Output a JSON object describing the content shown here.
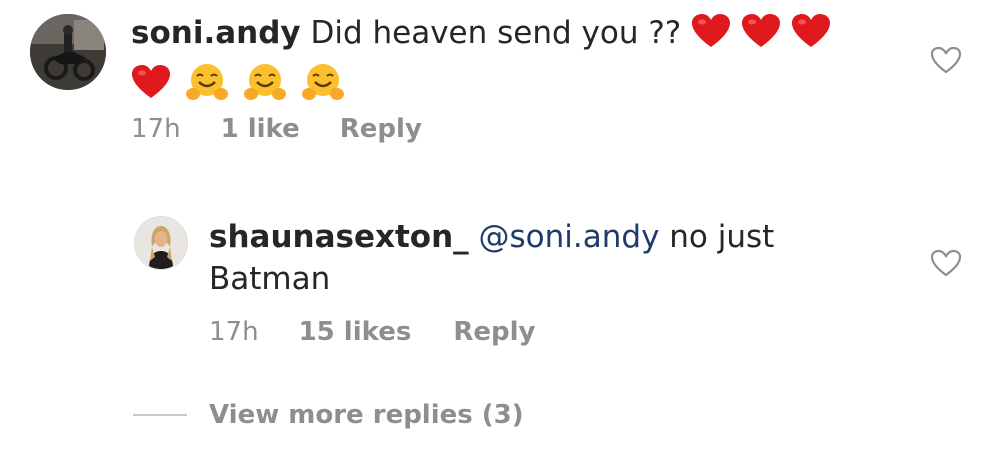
{
  "comments": [
    {
      "username": "soni.andy",
      "text": "Did heaven send you ??",
      "emoji_line1": [
        "heart",
        "heart",
        "heart"
      ],
      "emoji_line2": [
        "heart",
        "hug",
        "hug",
        "hug"
      ],
      "time": "17h",
      "likes": "1 like",
      "reply": "Reply"
    }
  ],
  "replies": [
    {
      "username": "shaunasexton_",
      "mention": "@soni.andy",
      "text_line1": "no just",
      "text_line2": "Batman",
      "time": "17h",
      "likes": "15 likes",
      "reply": "Reply"
    }
  ],
  "view_more": "View more replies (3)",
  "icons": {
    "like": "heart-outline-icon",
    "emoji_heart": "red-heart-emoji",
    "emoji_hug": "hugging-face-emoji"
  },
  "colors": {
    "text": "#262626",
    "meta": "#8e8e8e",
    "mention": "#1f3b69",
    "heart_red": "#e0191f"
  }
}
